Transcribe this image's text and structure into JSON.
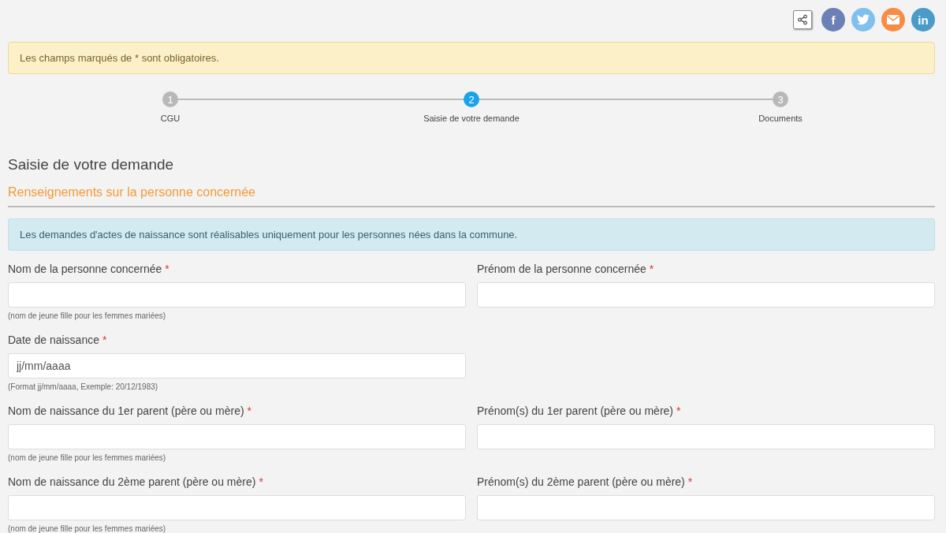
{
  "share": {
    "buttons": [
      {
        "kind": "share",
        "color": "#ffffff"
      },
      {
        "kind": "facebook",
        "color": "#6b80b5",
        "glyph": "f"
      },
      {
        "kind": "twitter",
        "color": "#7fc0ec"
      },
      {
        "kind": "email",
        "color": "#f68d45"
      },
      {
        "kind": "linkedin",
        "color": "#4a9bc8",
        "glyph": "in"
      }
    ]
  },
  "notice": "Les champs marqués de * sont obligatoires.",
  "steps": [
    {
      "number": "1",
      "label": "CGU",
      "selected": false
    },
    {
      "number": "2",
      "label": "Saisie de votre demande",
      "selected": true
    },
    {
      "number": "3",
      "label": "Documents",
      "selected": false
    }
  ],
  "page_title": "Saisie de votre demande",
  "section_title": "Renseignements sur la personne concernée",
  "info": "Les demandes d'actes de naissance sont réalisables uniquement pour les personnes nées dans la commune.",
  "rows": [
    [
      {
        "label": "Nom de la personne concernée",
        "required": "*",
        "help": "(nom de jeune fille pour les femmes mariées)"
      },
      {
        "label": "Prénom de la personne concernée",
        "required": "*"
      }
    ],
    [
      {
        "label": "Date de naissance",
        "required": "*",
        "placeholder": "jj/mm/aaaa",
        "help": "(Format jj/mm/aaaa, Exemple: 20/12/1983)"
      }
    ],
    [
      {
        "label": "Nom de naissance du 1er parent (père ou mère)",
        "required": "*",
        "help": "(nom de jeune fille pour les femmes mariées)"
      },
      {
        "label": "Prénom(s) du 1er parent (père ou mère)",
        "required": "*"
      }
    ],
    [
      {
        "label": "Nom de naissance du 2ème parent (père ou mère)",
        "required": "*",
        "help": "(nom de jeune fille pour les femmes mariées)"
      },
      {
        "label": "Prénom(s) du 2ème parent (père ou mère)",
        "required": "*"
      }
    ]
  ]
}
